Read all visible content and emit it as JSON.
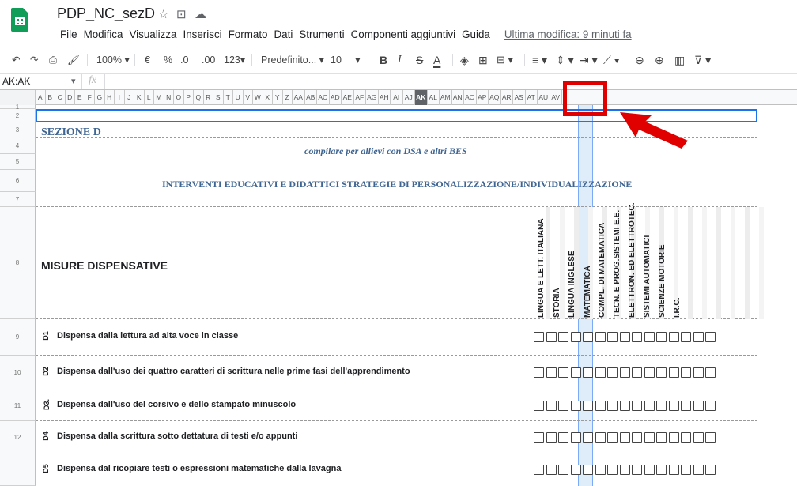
{
  "app": {
    "doc_title": "PDP_NC_sezD",
    "menus": [
      "File",
      "Modifica",
      "Visualizza",
      "Inserisci",
      "Formato",
      "Dati",
      "Strumenti",
      "Componenti aggiuntivi",
      "Guida"
    ],
    "last_edit": "Ultima modifica: 9 minuti fa"
  },
  "toolbar": {
    "zoom": "100%",
    "currency": "€",
    "percent": "%",
    "dec_less": ".0",
    "dec_more": ".00",
    "format_more": "123",
    "font": "Predefinito...",
    "font_size": "10",
    "bold": "B",
    "italic": "I",
    "strike": "S",
    "text_color": "A"
  },
  "formula_bar": {
    "name_box": "AK:AK",
    "fx": "fx"
  },
  "columns": [
    "A",
    "B",
    "C",
    "D",
    "E",
    "F",
    "G",
    "H",
    "I",
    "J",
    "K",
    "L",
    "M",
    "N",
    "O",
    "P",
    "Q",
    "R",
    "S",
    "T",
    "U",
    "V",
    "W",
    "X",
    "Y",
    "Z",
    "AA",
    "AB",
    "AC",
    "AD",
    "AE",
    "AF",
    "AG",
    "AH",
    "AI",
    "AJ",
    "AK",
    "AL",
    "AM",
    "AN",
    "AO",
    "AP",
    "AQ",
    "AR",
    "AS",
    "AT",
    "AU",
    "AV"
  ],
  "selected_column": "AK",
  "rows": [
    "1",
    "2",
    "3",
    "4",
    "5",
    "6",
    "7",
    "8",
    "9",
    "10",
    "11",
    "12"
  ],
  "sheet": {
    "section_title": "SEZIONE D",
    "subtitle": "compilare per allievi con DSA e altri BES",
    "heading": "INTERVENTI EDUCATIVI E DIDATTICI STRATEGIE DI PERSONALIZZAZIONE/INDIVIDUALIZZAZIONE",
    "misure_label": "MISURE DISPENSATIVE",
    "subjects": [
      "LINGUA E LETT. ITALIANA",
      "STORIA",
      "LINGUA INGLESE",
      "MATEMATICA",
      "COMPL. DI MATEMATICA",
      "TECN. E PROG.SISTEMI E.E.",
      "ELETTRON. ED ELETTROTEC.",
      "SISTEMI AUTOMATICI",
      "SCIENZE MOTORIE",
      "I.R.C."
    ],
    "items": [
      {
        "code": "D1",
        "text": "Dispensa dalla lettura ad alta voce in classe"
      },
      {
        "code": "D2",
        "text": "Dispensa dall'uso dei quattro caratteri di scrittura nelle prime fasi dell'apprendimento"
      },
      {
        "code": "D3.",
        "text": "Dispensa dall'uso del corsivo e dello stampato minuscolo"
      },
      {
        "code": "D4",
        "text": "Dispensa dalla scrittura sotto dettatura di testi e/o appunti"
      },
      {
        "code": "D5",
        "text": "Dispensa dal ricopiare testi o espressioni matematiche dalla lavagna"
      }
    ],
    "checkbox_count": 15
  },
  "colors": {
    "highlight": "#e00000",
    "accent": "#1a73e8",
    "section": "#3f6592"
  }
}
